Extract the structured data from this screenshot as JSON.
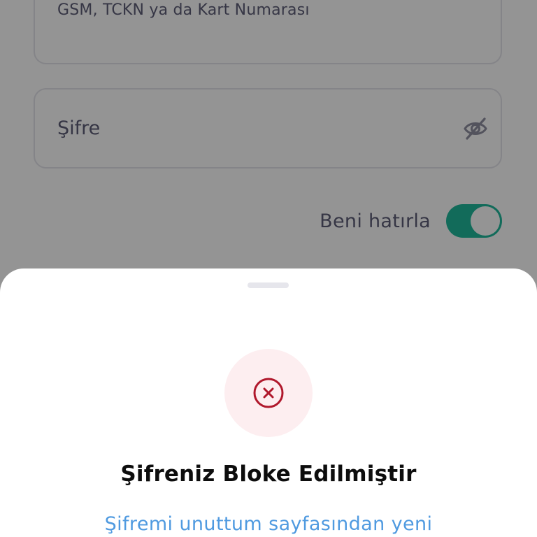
{
  "login": {
    "id_field": {
      "label": "GSM, TCKN ya da Kart Numarası",
      "value": ""
    },
    "password_field": {
      "placeholder": "Şifre",
      "toggle_icon": "eye-off-icon"
    },
    "remember_me": {
      "label": "Beni hatırla",
      "enabled": true
    }
  },
  "sheet": {
    "status_icon": "close-circle-icon",
    "title": "Şifreniz Bloke Edilmiştir",
    "message": "Şifremi unuttum sayfasından yeni"
  },
  "colors": {
    "accent_toggle": "#1fb89c",
    "error_red": "#b0182c",
    "error_bg": "#fdeef0",
    "link_blue": "#4f9ae0"
  }
}
